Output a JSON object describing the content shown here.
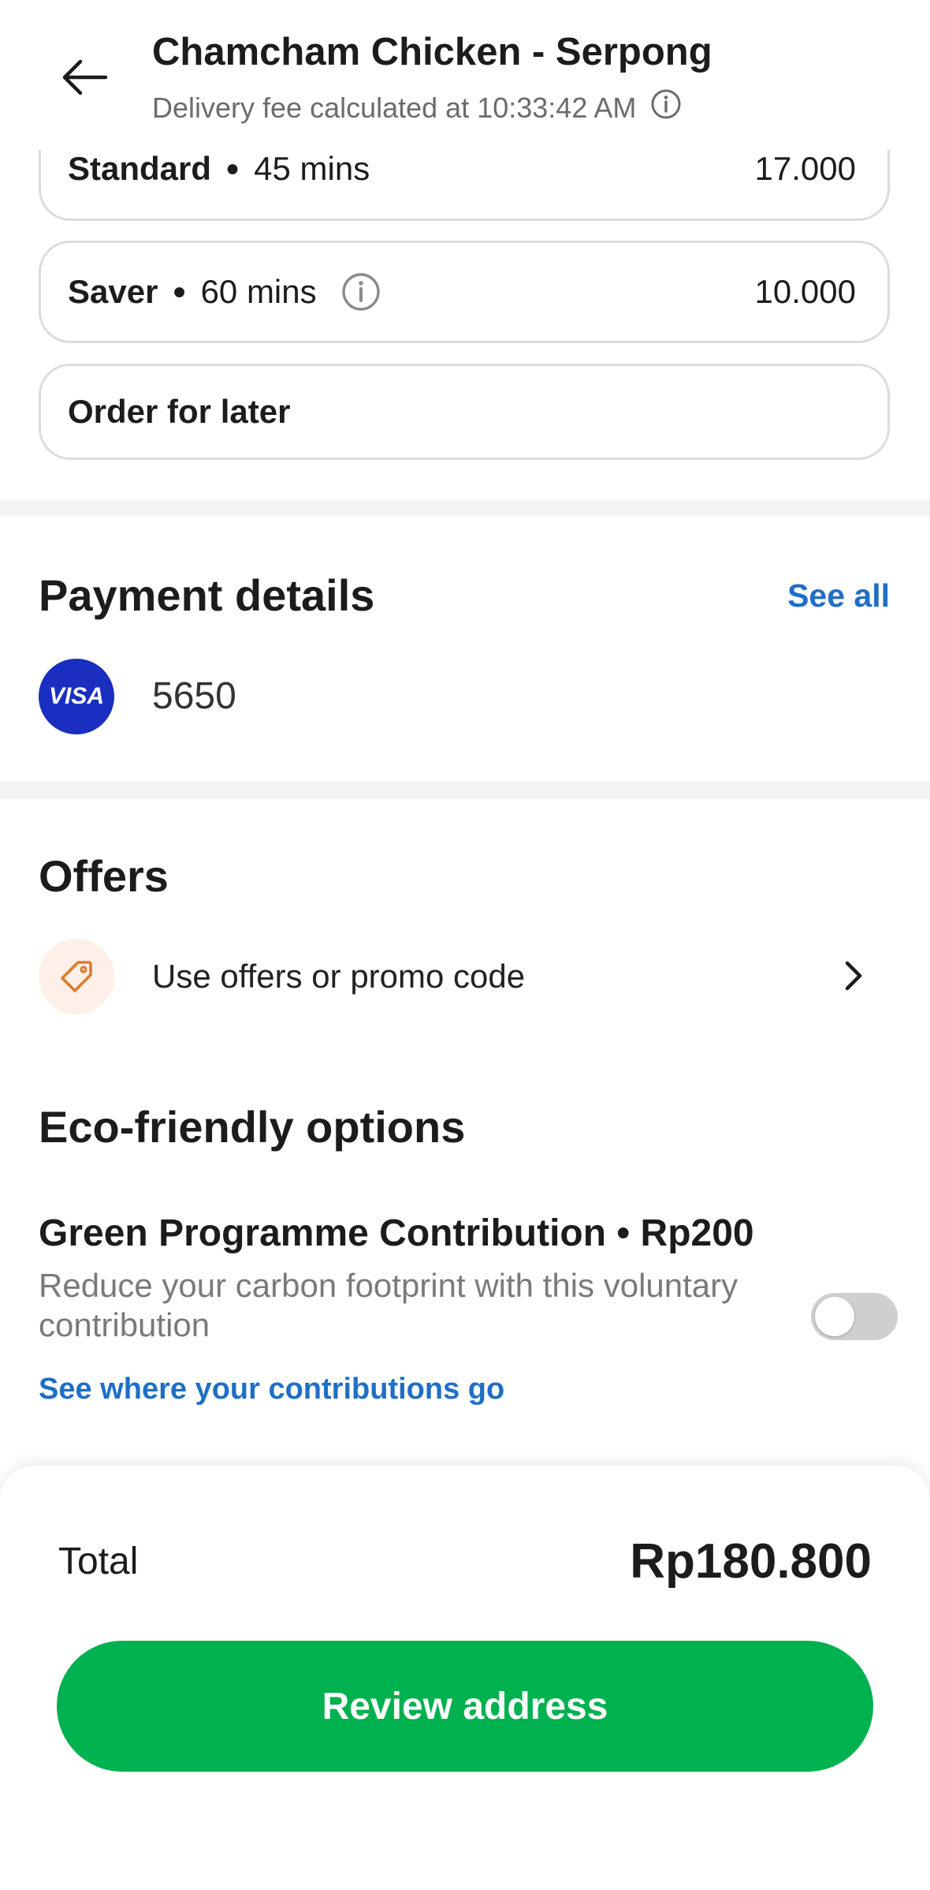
{
  "header": {
    "title": "Chamcham Chicken - Serpong",
    "subtitle": "Delivery fee calculated at 10:33:42 AM",
    "back_icon": "arrow-left-icon",
    "info_icon": "info-circle-icon"
  },
  "delivery_options": [
    {
      "name": "Standard",
      "time": "45 mins",
      "price": "17.000"
    },
    {
      "name": "Saver",
      "time": "60 mins",
      "price": "10.000",
      "info_icon": "info-circle-icon"
    },
    {
      "name": "Order for later"
    }
  ],
  "payment": {
    "title": "Payment details",
    "see_all": "See all",
    "card_brand": "VISA",
    "card_last4": "5650"
  },
  "offers": {
    "title": "Offers",
    "item_label": "Use offers or promo code",
    "icon": "tag-icon",
    "chevron": "chevron-right-icon"
  },
  "eco": {
    "title": "Eco-friendly options",
    "item_name": "Green Programme Contribution • Rp200",
    "item_desc": "Reduce your carbon footprint with this voluntary contribution",
    "toggle_on": false,
    "link": "See where your contributions go"
  },
  "footer": {
    "total_label": "Total",
    "total_amount": "Rp180.800",
    "review_button": "Review address"
  },
  "colors": {
    "accent_blue": "#1f6fc5",
    "brand_green": "#00b14f",
    "visa_blue": "#1a2fbf",
    "offer_orange": "#e07a2e"
  }
}
